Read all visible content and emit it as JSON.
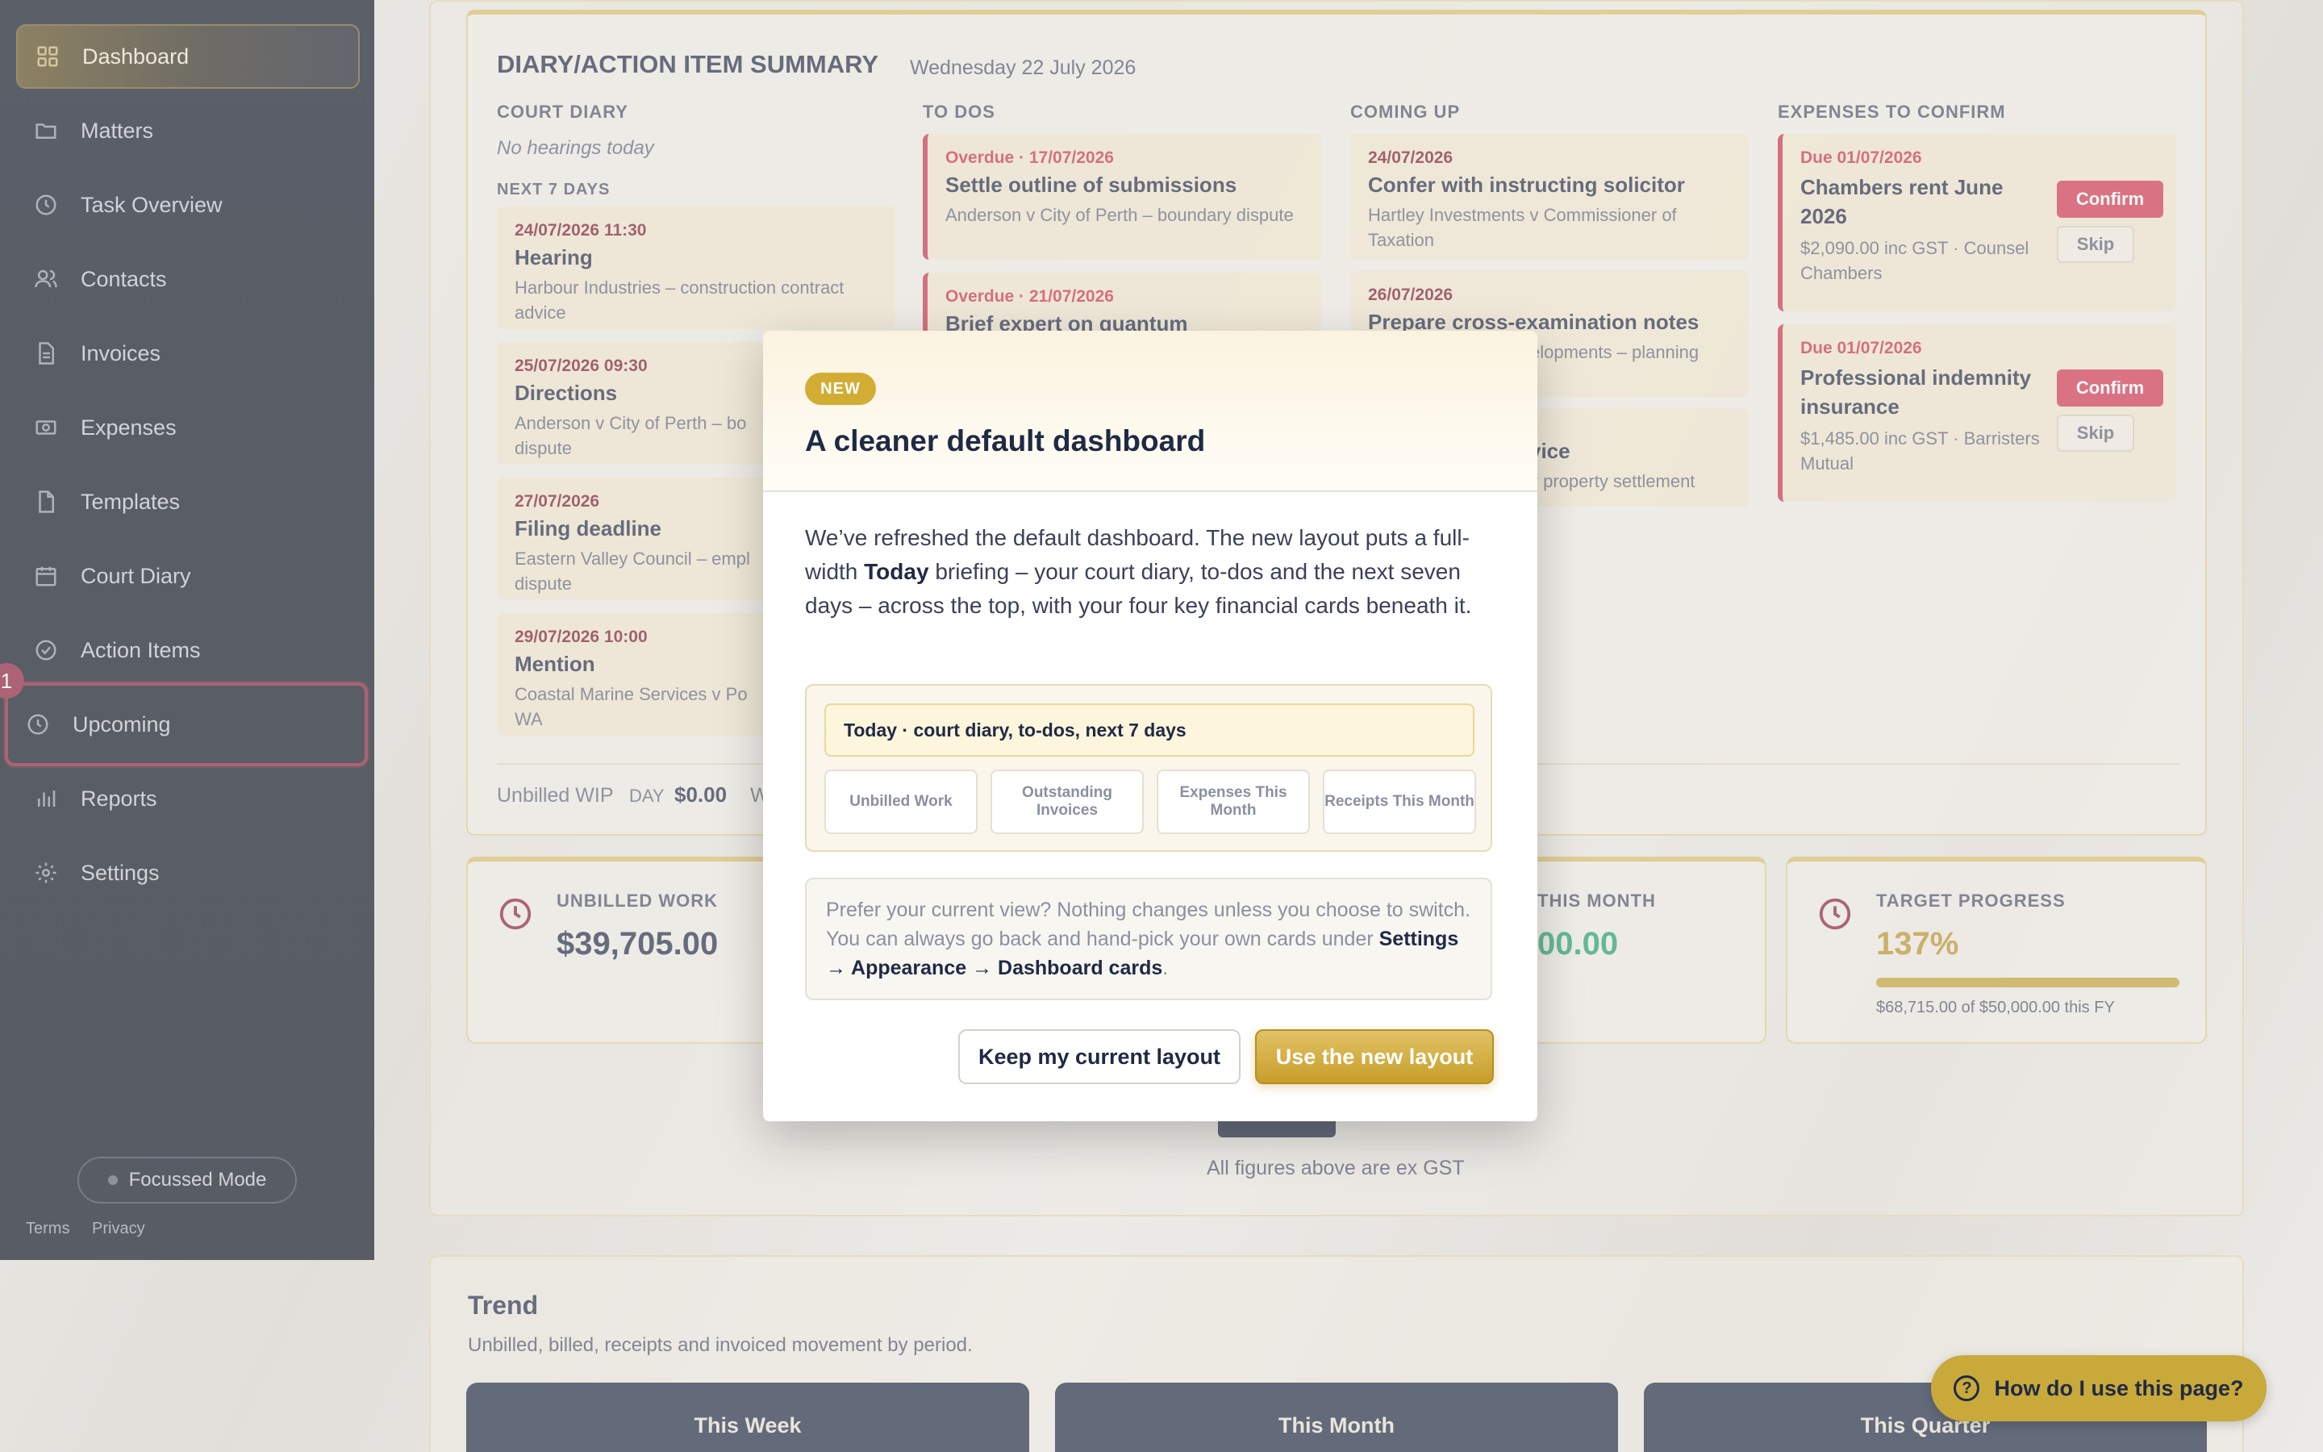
{
  "sidebar": {
    "items": [
      {
        "label": "Dashboard",
        "icon": "grid-icon"
      },
      {
        "label": "Matters",
        "icon": "folder-icon"
      },
      {
        "label": "Task Overview",
        "icon": "clock-icon"
      },
      {
        "label": "Contacts",
        "icon": "users-icon"
      },
      {
        "label": "Invoices",
        "icon": "document-icon"
      },
      {
        "label": "Expenses",
        "icon": "money-icon"
      },
      {
        "label": "Templates",
        "icon": "file-icon"
      },
      {
        "label": "Court Diary",
        "icon": "calendar-icon"
      },
      {
        "label": "Action Items",
        "icon": "check-circle-icon"
      },
      {
        "label": "Upcoming",
        "icon": "clock-icon"
      },
      {
        "label": "Reports",
        "icon": "bar-chart-icon"
      },
      {
        "label": "Settings",
        "icon": "gear-icon"
      }
    ],
    "upcoming_badge": "1",
    "focussed_mode": "Focussed Mode",
    "terms": "Terms",
    "privacy": "Privacy"
  },
  "summary": {
    "title": "DIARY/ACTION ITEM SUMMARY",
    "date": "Wednesday 22 July 2026",
    "court_diary": {
      "heading": "COURT DIARY",
      "today": "No hearings today",
      "next7_heading": "NEXT 7 DAYS",
      "items": [
        {
          "date": "24/07/2026 11:30",
          "title": "Hearing",
          "detail": "Harbour Industries – construction contract advice"
        },
        {
          "date": "25/07/2026 09:30",
          "title": "Directions",
          "detail": "Anderson v City of Perth – bo dispute"
        },
        {
          "date": "27/07/2026",
          "title": "Filing deadline",
          "detail": "Eastern Valley Council – empl dispute"
        },
        {
          "date": "29/07/2026 10:00",
          "title": "Mention",
          "detail": "Coastal Marine Services v Po WA"
        }
      ]
    },
    "todos": {
      "heading": "TO DOS",
      "items": [
        {
          "date": "Overdue · 17/07/2026",
          "title": "Settle outline of submissions",
          "detail": "Anderson v City of Perth – boundary dispute"
        },
        {
          "date": "Overdue · 21/07/2026",
          "title": "Brief expert on quantum",
          "detail": ""
        }
      ]
    },
    "coming_up": {
      "heading": "COMING UP",
      "items": [
        {
          "date": "24/07/2026",
          "title": "Confer with instructing solicitor",
          "detail": "Hartley Investments v Commissioner of Taxation"
        },
        {
          "date": "26/07/2026",
          "title": "Prepare cross-examination notes",
          "detail": "velopments – planning"
        },
        {
          "date": "",
          "title": "vice",
          "detail": "y property settlement"
        }
      ]
    },
    "expenses": {
      "heading": "EXPENSES TO CONFIRM",
      "items": [
        {
          "date": "Due 01/07/2026",
          "title": "Chambers rent June 2026",
          "detail": "$2,090.00 inc GST · Counsel Chambers"
        },
        {
          "date": "Due 01/07/2026",
          "title": "Professional indemnity insurance",
          "detail": "$1,485.00 inc GST · Barristers Mutual"
        }
      ],
      "confirm_label": "Confirm",
      "skip_label": "Skip"
    },
    "wip_label": "Unbilled WIP",
    "wip_day_label": "DAY",
    "wip_day_value": "$0.00",
    "wip_week_fragment": "W"
  },
  "cards": {
    "unbilled": {
      "label": "UNBILLED WORK",
      "value": "$39,705.00"
    },
    "month_fragment": {
      "label": "THIS MONTH",
      "value": "00.00"
    },
    "target": {
      "label": "TARGET PROGRESS",
      "value": "137%",
      "progress": 1.0,
      "detail": "$68,715.00 of $50,000.00 this FY"
    }
  },
  "figures_note": "All figures above are ex GST",
  "trend": {
    "title": "Trend",
    "subtitle": "Unbilled, billed, receipts and invoiced movement by period.",
    "tabs": [
      "This Week",
      "This Month",
      "This Quarter"
    ]
  },
  "help_button": "How do I use this page?",
  "modal": {
    "badge": "NEW",
    "title": "A cleaner default dashboard",
    "body_1": "We’ve refreshed the default dashboard. The new layout puts a full-width ",
    "body_bold": "Today",
    "body_2": " briefing – your court diary, to-dos and the next seven days – across the top, with your four key financial cards beneath it.",
    "preview_today": "Today · court diary, to-dos, next 7 days",
    "preview_cards": [
      "Unbilled Work",
      "Outstanding Invoices",
      "Expenses This Month",
      "Receipts This Month"
    ],
    "note_text": "Prefer your current view? Nothing changes unless you choose to switch. You can always go back and hand-pick your own cards under ",
    "note_path": "Settings → Appearance → Dashboard cards",
    "note_end": ".",
    "keep_button": "Keep my current layout",
    "use_button": "Use the new layout"
  },
  "colors": {
    "accent": "#c9a93a",
    "danger": "#d03550",
    "navy": "#0d1626",
    "green": "#1d9e6a",
    "gold_text": "#b8932a"
  }
}
